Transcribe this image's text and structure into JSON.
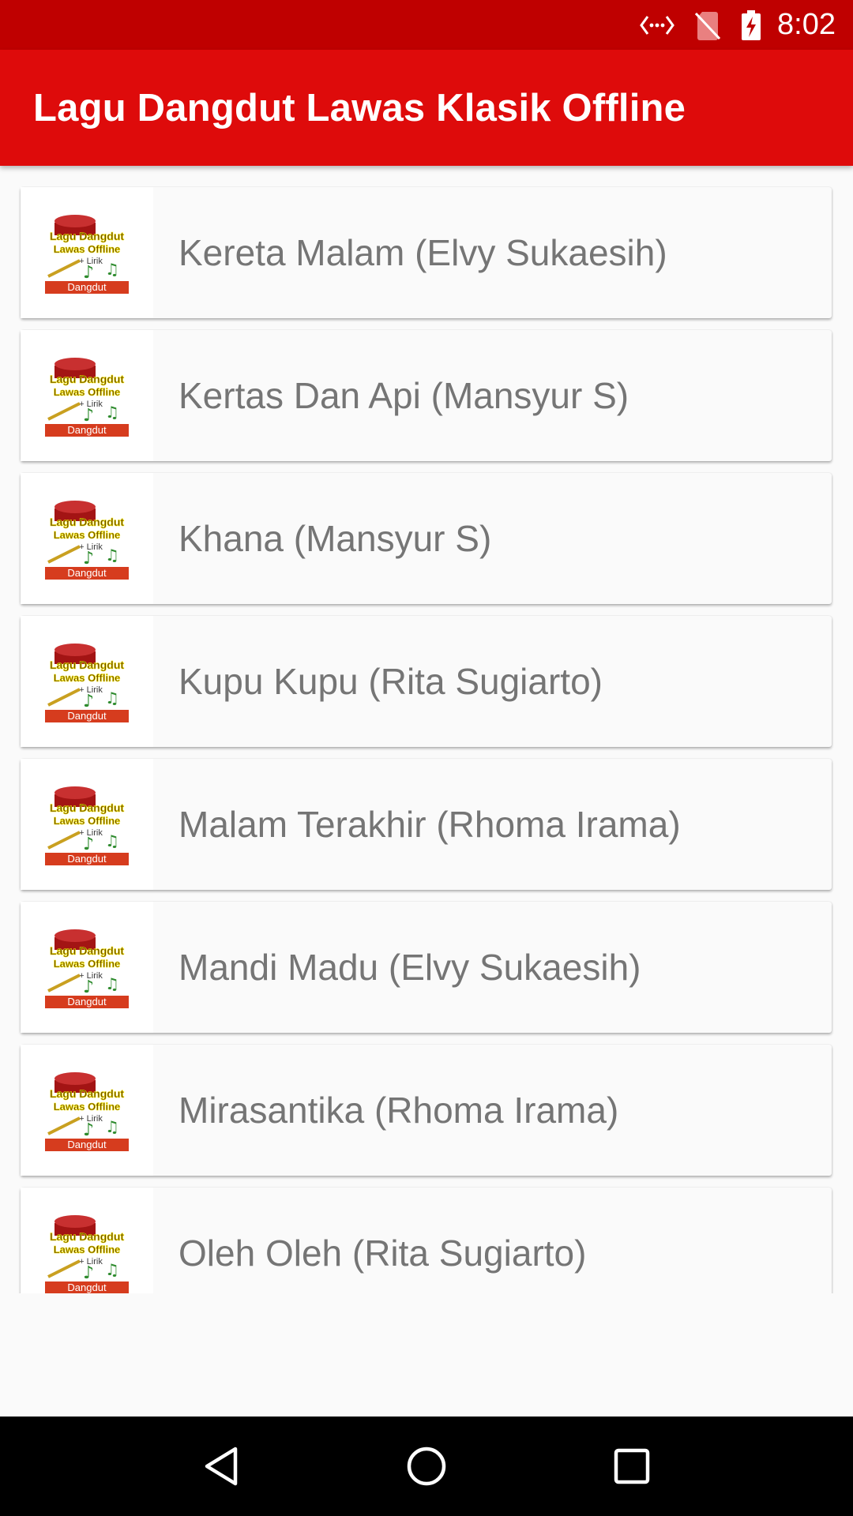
{
  "status_bar": {
    "time": "8:02",
    "icons": [
      "developer-mode-icon",
      "no-sim-icon",
      "battery-charging-icon"
    ],
    "background_color": "#bf0000"
  },
  "app_bar": {
    "title": "Lagu Dangdut Lawas Klasik Offline",
    "background_color": "#de0b0b"
  },
  "songs": [
    {
      "title": "Kereta Malam (Elvy Sukaesih)"
    },
    {
      "title": "Kertas Dan Api (Mansyur S)"
    },
    {
      "title": "Khana (Mansyur S)"
    },
    {
      "title": "Kupu Kupu (Rita Sugiarto)"
    },
    {
      "title": "Malam Terakhir (Rhoma Irama)"
    },
    {
      "title": "Mandi Madu (Elvy Sukaesih)"
    },
    {
      "title": "Mirasantika (Rhoma Irama)"
    },
    {
      "title": "Oleh Oleh (Rita Sugiarto)"
    }
  ],
  "thumbnail": {
    "line1": "Lagu Dangdut",
    "line2": "Lawas Offline",
    "line3": "+ Lirik",
    "banner": "Dangdut"
  },
  "nav_bar": {
    "buttons": [
      "back-icon",
      "home-icon",
      "recents-icon"
    ]
  }
}
